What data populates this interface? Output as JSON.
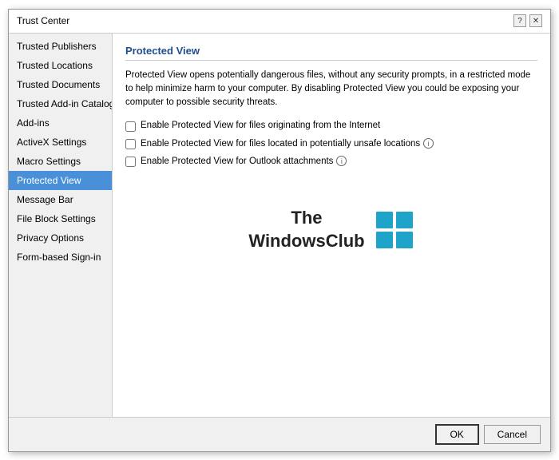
{
  "dialog": {
    "title": "Trust Center",
    "help_btn": "?",
    "close_btn": "✕"
  },
  "sidebar": {
    "items": [
      {
        "id": "trusted-publishers",
        "label": "Trusted Publishers"
      },
      {
        "id": "trusted-locations",
        "label": "Trusted Locations"
      },
      {
        "id": "trusted-documents",
        "label": "Trusted Documents"
      },
      {
        "id": "trusted-add-in-catalogs",
        "label": "Trusted Add-in Catalogs"
      },
      {
        "id": "add-ins",
        "label": "Add-ins"
      },
      {
        "id": "activex-settings",
        "label": "ActiveX Settings"
      },
      {
        "id": "macro-settings",
        "label": "Macro Settings"
      },
      {
        "id": "protected-view",
        "label": "Protected View",
        "active": true
      },
      {
        "id": "message-bar",
        "label": "Message Bar"
      },
      {
        "id": "file-block-settings",
        "label": "File Block Settings"
      },
      {
        "id": "privacy-options",
        "label": "Privacy Options"
      },
      {
        "id": "form-based-sign-in",
        "label": "Form-based Sign-in"
      }
    ]
  },
  "main": {
    "section_title": "Protected View",
    "description": "Protected View opens potentially dangerous files, without any security prompts, in a restricted mode to help minimize harm to your computer. By disabling Protected View you could be exposing your computer to possible security threats.",
    "checkboxes": [
      {
        "id": "internet-files",
        "label": "Enable Protected View for files originating from the Internet",
        "checked": false,
        "has_info": false
      },
      {
        "id": "unsafe-locations",
        "label": "Enable Protected View for files located in potentially unsafe locations",
        "checked": false,
        "has_info": true
      },
      {
        "id": "outlook-attachments",
        "label": "Enable Protected View for Outlook attachments",
        "checked": false,
        "has_info": true
      }
    ],
    "logo": {
      "text_line1": "The",
      "text_line2": "WindowsClub",
      "icon_color": "#1da4c8"
    }
  },
  "footer": {
    "ok_label": "OK",
    "cancel_label": "Cancel"
  },
  "icons": {
    "info": "i",
    "flag_shape": "flag"
  }
}
